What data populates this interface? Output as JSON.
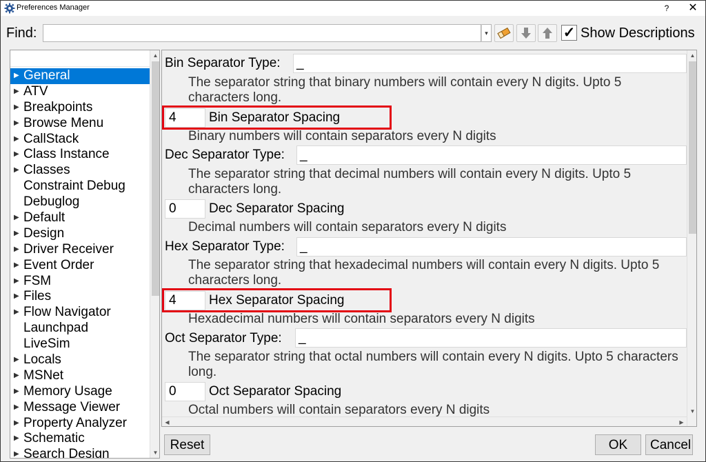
{
  "window": {
    "title": "Preferences Manager",
    "help_symbol": "?",
    "close_symbol": "✕"
  },
  "find": {
    "label": "Find:",
    "value": "",
    "dropdown_symbol": "▾",
    "show_descriptions_label": "Show Descriptions",
    "show_descriptions_checked": "✓"
  },
  "tree": {
    "items": [
      {
        "label": "General",
        "arrow": "▶",
        "selected": true
      },
      {
        "label": "ATV",
        "arrow": "▶"
      },
      {
        "label": "Breakpoints",
        "arrow": "▶"
      },
      {
        "label": "Browse Menu",
        "arrow": "▶"
      },
      {
        "label": "CallStack",
        "arrow": "▶"
      },
      {
        "label": "Class Instance",
        "arrow": "▶"
      },
      {
        "label": "Classes",
        "arrow": "▶"
      },
      {
        "label": "Constraint Debug",
        "arrow": ""
      },
      {
        "label": "Debuglog",
        "arrow": ""
      },
      {
        "label": "Default",
        "arrow": "▶"
      },
      {
        "label": "Design",
        "arrow": "▶"
      },
      {
        "label": "Driver Receiver",
        "arrow": "▶"
      },
      {
        "label": "Event Order",
        "arrow": "▶"
      },
      {
        "label": "FSM",
        "arrow": "▶"
      },
      {
        "label": "Files",
        "arrow": "▶"
      },
      {
        "label": "Flow Navigator",
        "arrow": "▶"
      },
      {
        "label": "Launchpad",
        "arrow": ""
      },
      {
        "label": "LiveSim",
        "arrow": ""
      },
      {
        "label": "Locals",
        "arrow": "▶"
      },
      {
        "label": "MSNet",
        "arrow": "▶"
      },
      {
        "label": "Memory Usage",
        "arrow": "▶"
      },
      {
        "label": "Message Viewer",
        "arrow": "▶"
      },
      {
        "label": "Property Analyzer",
        "arrow": "▶"
      },
      {
        "label": "Schematic",
        "arrow": "▶"
      },
      {
        "label": "Search Design",
        "arrow": "▶"
      }
    ]
  },
  "settings": {
    "bin_type_label": "Bin Separator Type:",
    "bin_type_value": "_",
    "bin_type_desc": "The separator string that binary numbers will contain every N digits. Upto 5 characters long.",
    "bin_spacing_value": "4",
    "bin_spacing_label": "Bin Separator Spacing",
    "bin_spacing_desc": "Binary numbers will contain separators every N digits",
    "dec_type_label": "Dec Separator Type:",
    "dec_type_value": "_",
    "dec_type_desc": "The separator string that decimal numbers will contain every N digits. Upto 5 characters long.",
    "dec_spacing_value": "0",
    "dec_spacing_label": "Dec Separator Spacing",
    "dec_spacing_desc": "Decimal numbers will contain separators every N digits",
    "hex_type_label": "Hex Separator Type:",
    "hex_type_value": "_",
    "hex_type_desc": "The separator string that hexadecimal numbers will contain every N digits. Upto 5 characters long.",
    "hex_spacing_value": "4",
    "hex_spacing_label": "Hex Separator Spacing",
    "hex_spacing_desc": "Hexadecimal numbers will contain separators every N digits",
    "oct_type_label": "Oct Separator Type:",
    "oct_type_value": "_",
    "oct_type_desc": "The separator string that octal numbers will contain every N digits. Upto 5 characters long.",
    "oct_spacing_value": "0",
    "oct_spacing_label": "Oct Separator Spacing",
    "oct_spacing_desc": "Octal numbers will contain separators every N digits"
  },
  "buttons": {
    "reset": "Reset",
    "ok": "OK",
    "cancel": "Cancel"
  },
  "colors": {
    "selection": "#0078d7",
    "highlight_box": "#e30613"
  }
}
